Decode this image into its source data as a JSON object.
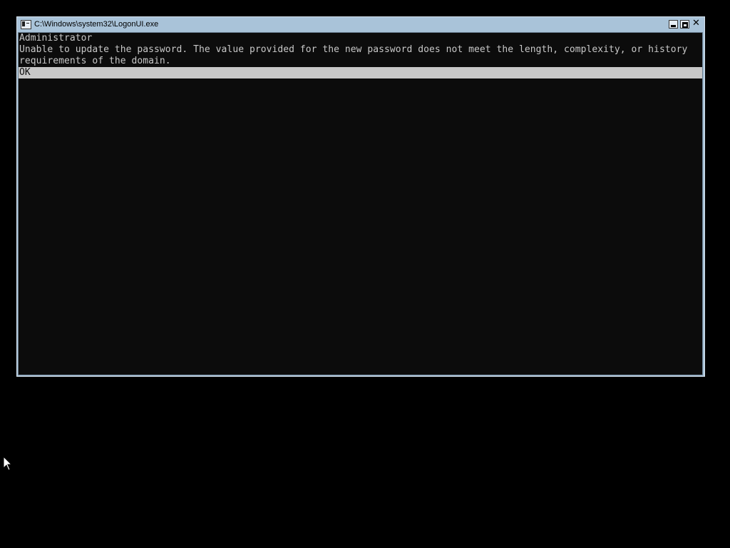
{
  "window": {
    "title": "C:\\Windows\\system32\\LogonUI.exe",
    "controls": {
      "minimize_icon": "minimize-icon",
      "maximize_icon": "maximize-icon",
      "close_glyph": "✕"
    }
  },
  "console": {
    "user": "Administrator",
    "message_line1": "Unable to update the password. The value provided for the new password does not meet the length, complexity, or history",
    "message_line2": "requirements of the domain.",
    "ok_label": "OK"
  },
  "colors": {
    "background": "#000000",
    "titlebar": "#a9c3d9",
    "console_bg": "#0c0c0c",
    "console_fg": "#c8c8c8",
    "selection_bg": "#c8c8c8"
  }
}
